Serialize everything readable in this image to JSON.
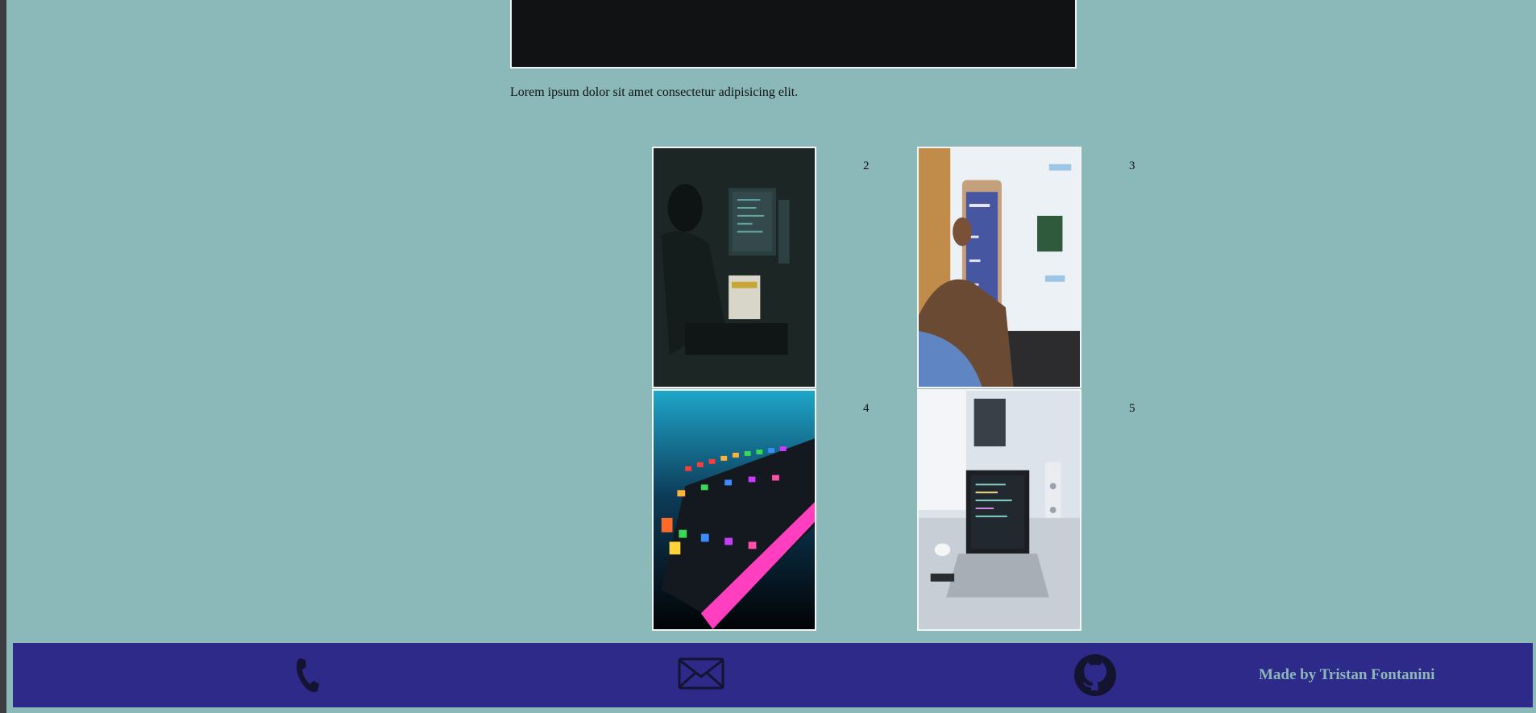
{
  "main": {
    "intro_text": "Lorem ipsum dolor sit amet consectetur adipisicing elit."
  },
  "gallery": {
    "items": [
      {
        "number": "2",
        "image": "hacker-at-monitors-photo"
      },
      {
        "number": "3",
        "image": "hand-holding-phone-photo"
      },
      {
        "number": "4",
        "image": "rgb-keyboard-photo"
      },
      {
        "number": "5",
        "image": "laptop-on-desk-photo"
      }
    ]
  },
  "footer": {
    "icons": [
      "phone-icon",
      "mail-icon",
      "github-icon"
    ],
    "credit": "Made by Tristan Fontanini"
  },
  "colors": {
    "page_background": "#8bb8b8",
    "footer_background": "#2d2a8a",
    "credit_text": "#8bb8b8"
  }
}
